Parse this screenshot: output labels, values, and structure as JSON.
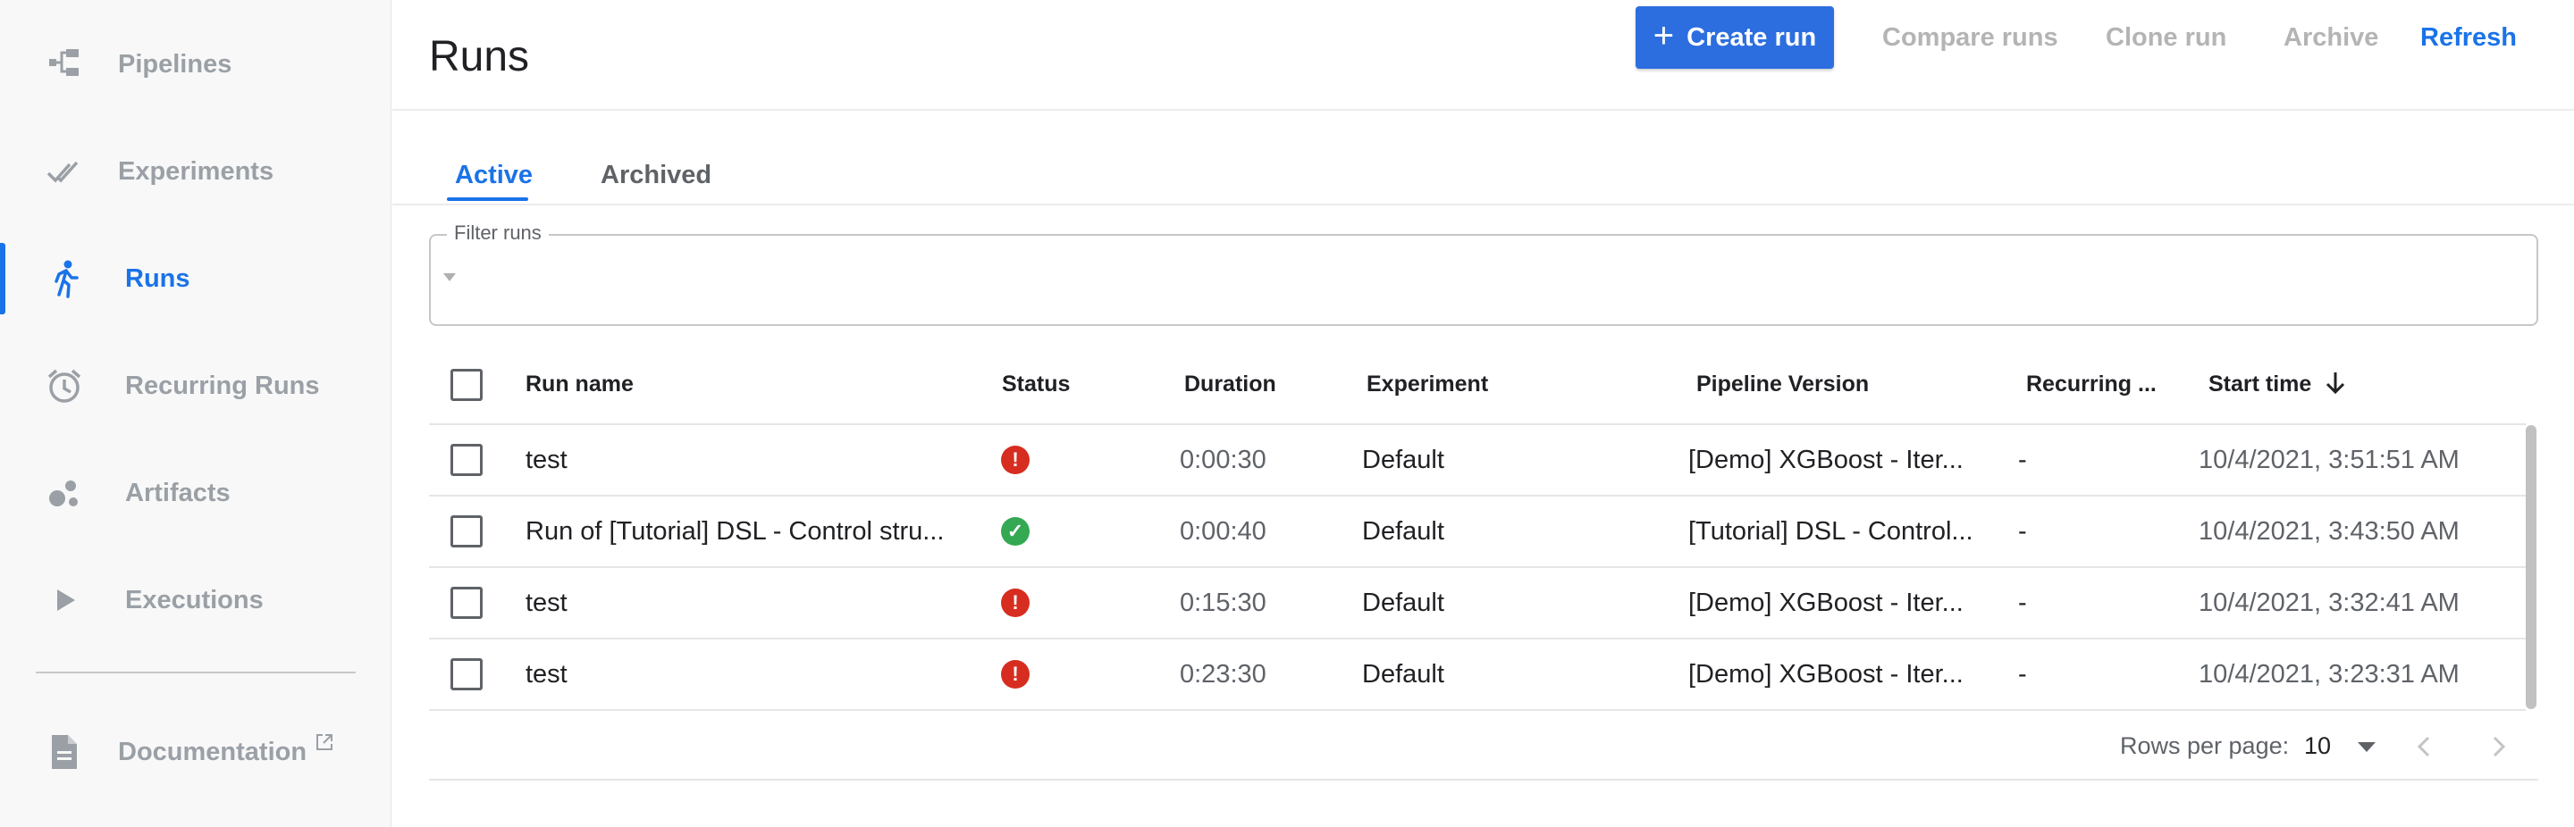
{
  "sidebar": {
    "items": [
      {
        "label": "Pipelines",
        "icon": "pipelines-icon"
      },
      {
        "label": "Experiments",
        "icon": "experiments-icon"
      },
      {
        "label": "Runs",
        "icon": "runs-icon",
        "active": true
      },
      {
        "label": "Recurring Runs",
        "icon": "alarm-clock-icon"
      },
      {
        "label": "Artifacts",
        "icon": "artifacts-icon"
      },
      {
        "label": "Executions",
        "icon": "play-icon"
      }
    ],
    "documentation": {
      "label": "Documentation",
      "icon": "document-icon",
      "external_icon": "external-link-icon"
    }
  },
  "header": {
    "title": "Runs",
    "create_run": "Create run",
    "compare_runs": "Compare runs",
    "clone_run": "Clone run",
    "archive": "Archive",
    "refresh": "Refresh"
  },
  "tabs": {
    "active": "Active",
    "archived": "Archived"
  },
  "filter": {
    "label": "Filter runs",
    "value": ""
  },
  "table": {
    "columns": {
      "run_name": "Run name",
      "status": "Status",
      "duration": "Duration",
      "experiment": "Experiment",
      "pipeline_version": "Pipeline Version",
      "recurring": "Recurring ...",
      "start_time": "Start time"
    },
    "sort": {
      "column": "start_time",
      "direction": "descending"
    },
    "rows": [
      {
        "run_name": "test",
        "status": "error",
        "duration": "0:00:30",
        "experiment": "Default",
        "pipeline_version": "[Demo] XGBoost - Iter...",
        "recurring": "-",
        "start_time": "10/4/2021, 3:51:51 AM"
      },
      {
        "run_name": "Run of [Tutorial] DSL - Control stru...",
        "status": "success",
        "duration": "0:00:40",
        "experiment": "Default",
        "pipeline_version": "[Tutorial] DSL - Control...",
        "recurring": "-",
        "start_time": "10/4/2021, 3:43:50 AM"
      },
      {
        "run_name": "test",
        "status": "error",
        "duration": "0:15:30",
        "experiment": "Default",
        "pipeline_version": "[Demo] XGBoost - Iter...",
        "recurring": "-",
        "start_time": "10/4/2021, 3:32:41 AM"
      },
      {
        "run_name": "test",
        "status": "error",
        "duration": "0:23:30",
        "experiment": "Default",
        "pipeline_version": "[Demo] XGBoost - Iter...",
        "recurring": "-",
        "start_time": "10/4/2021, 3:23:31 AM"
      }
    ]
  },
  "pagination": {
    "rows_per_page_label": "Rows per page:",
    "rows_per_page": "10"
  },
  "colors": {
    "accent": "#1a73e8",
    "error": "#d62d20",
    "success": "#34a853",
    "disabled": "#b4b4b4"
  }
}
